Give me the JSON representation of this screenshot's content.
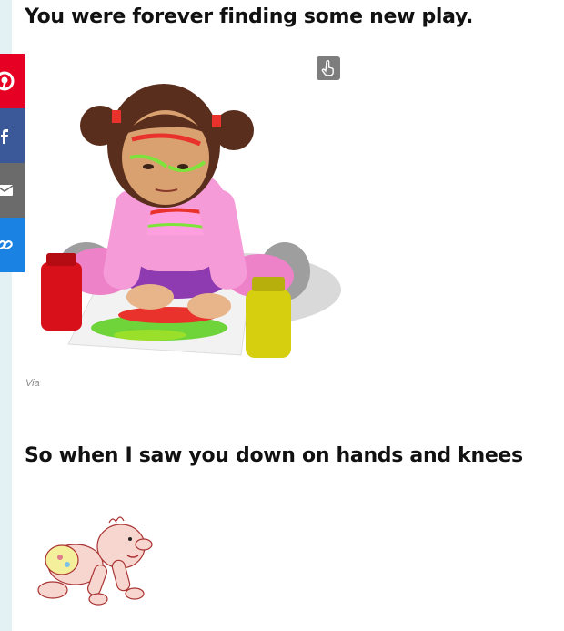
{
  "article": {
    "heading_1": "You were forever finding some new play.",
    "image_1": {
      "credit": "Via",
      "alt": "girl-finger-painting-gif"
    },
    "heading_2": "So when I saw you down on hands and knees",
    "image_2": {
      "alt": "crawling-baby-gif"
    }
  },
  "share_bar": {
    "buttons": [
      {
        "name": "pinterest",
        "icon": "pinterest-icon",
        "color": "#e60023"
      },
      {
        "name": "facebook",
        "icon": "facebook-icon",
        "color": "#3b5998"
      },
      {
        "name": "email",
        "icon": "mail-icon",
        "color": "#6b6b6b"
      },
      {
        "name": "link",
        "icon": "link-icon",
        "color": "#1a82e2"
      }
    ]
  },
  "colors": {
    "rail": "#e3f1f4",
    "tap_icon_bg": "#7d7d7d"
  }
}
